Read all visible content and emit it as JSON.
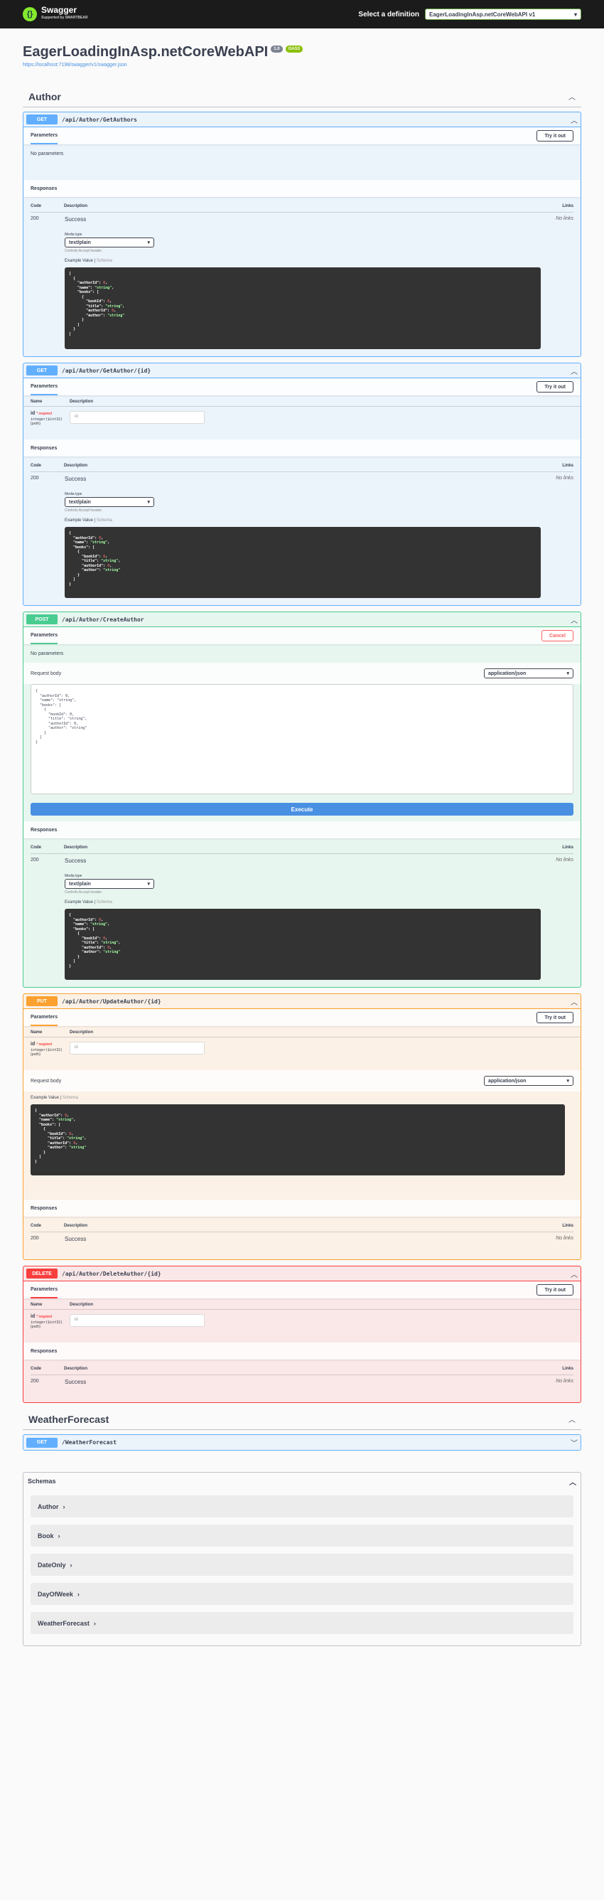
{
  "topbar": {
    "logo": "Swagger",
    "logo_sub": "Supported by SMARTBEAR",
    "select_label": "Select a definition",
    "definition": "EagerLoadingInAsp.netCoreWebAPI v1"
  },
  "info": {
    "title": "EagerLoadingInAsp.netCoreWebAPI",
    "version": "1.0",
    "oas": "OAS3",
    "url": "https://localhost:7198/swagger/v1/swagger.json"
  },
  "labels": {
    "parameters": "Parameters",
    "try_it_out": "Try it out",
    "cancel": "Cancel",
    "no_parameters": "No parameters",
    "responses": "Responses",
    "code": "Code",
    "description": "Description",
    "links": "Links",
    "success": "Success",
    "no_links": "No links",
    "media_type": "Media type",
    "media_type_value": "text/plain",
    "controls": "Controls Accept header.",
    "example_value": "Example Value",
    "schema": "Schema",
    "name": "Name",
    "required": "* required",
    "request_body": "Request body",
    "content_type": "application/json",
    "execute": "Execute",
    "param_type": "integer($int32)",
    "param_in": "(path)",
    "param_name": "id",
    "param_placeholder": "id",
    "status_code": "200"
  },
  "tags": {
    "author": "Author",
    "weather": "WeatherForecast"
  },
  "ops": [
    {
      "method": "GET",
      "path": "/api/Author/GetAuthors"
    },
    {
      "method": "GET",
      "path": "/api/Author/GetAuthor/{id}"
    },
    {
      "method": "POST",
      "path": "/api/Author/CreateAuthor"
    },
    {
      "method": "PUT",
      "path": "/api/Author/UpdateAuthor/{id}"
    },
    {
      "method": "DELETE",
      "path": "/api/Author/DeleteAuthor/{id}"
    },
    {
      "method": "GET",
      "path": "/WeatherForecast"
    }
  ],
  "schemas": {
    "title": "Schemas",
    "items": [
      "Author",
      "Book",
      "DateOnly",
      "DayOfWeek",
      "WeatherForecast"
    ]
  },
  "colors": {
    "get": "#61affe",
    "post": "#49cc90",
    "put": "#fca130",
    "delete": "#f93e3e"
  }
}
